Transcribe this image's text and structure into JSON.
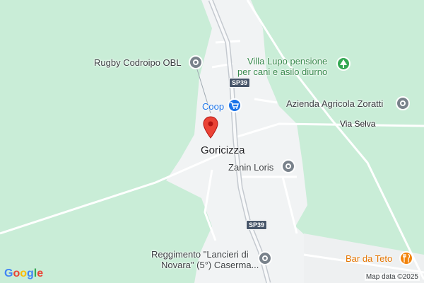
{
  "map": {
    "town": "Goricizza",
    "colors": {
      "land": "#c9edd7",
      "town_area": "#f1f3f4",
      "road": "#ffffff",
      "main_road": "#d2d6db",
      "pin": "#ea4335"
    }
  },
  "places": [
    {
      "id": "rugby",
      "label": "Rugby Codroipo OBL",
      "icon": "pin-circle-icon",
      "color": "gray"
    },
    {
      "id": "villa",
      "label_line1": "Villa Lupo pensione",
      "label_line2": "per cani e asilo diurno",
      "icon": "tree-icon",
      "color": "green"
    },
    {
      "id": "coop",
      "label": "Coop",
      "icon": "shopping-cart-icon",
      "color": "blue"
    },
    {
      "id": "azienda",
      "label": "Azienda Agricola Zoratti",
      "icon": "pin-circle-icon",
      "color": "gray"
    },
    {
      "id": "zanin",
      "label": "Zanin Loris",
      "icon": "pin-circle-icon",
      "color": "gray"
    },
    {
      "id": "reggimento",
      "label_line1": "Reggimento \"Lancieri di",
      "label_line2": "Novara\" (5°) Caserma...",
      "icon": "pin-circle-icon",
      "color": "gray"
    },
    {
      "id": "bar",
      "label": "Bar da Teto",
      "icon": "fork-knife-icon",
      "color": "orange"
    }
  ],
  "roads": {
    "sp39_top": "SP39",
    "sp39_bottom": "SP39",
    "via_selva": "Via Selva"
  },
  "footer": {
    "logo": "Google",
    "attribution": "Map data ©2025"
  }
}
